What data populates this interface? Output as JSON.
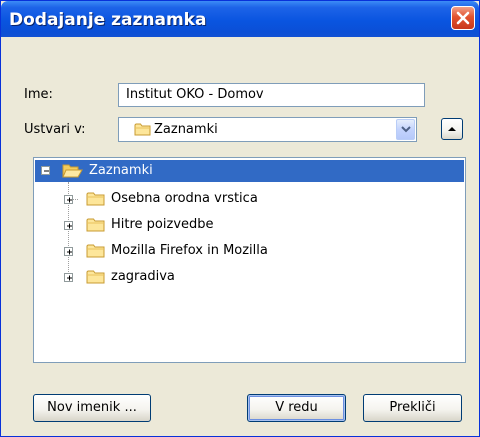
{
  "window": {
    "title": "Dodajanje zaznamka",
    "close_icon": "close-icon"
  },
  "form": {
    "name_label": "Ime:",
    "name_value": "Institut OKO - Domov",
    "create_in_label": "Ustvari v:",
    "create_in_value": "Zaznamki"
  },
  "tree": {
    "root": "Zaznamki",
    "items": [
      {
        "label": "Osebna orodna vrstica"
      },
      {
        "label": "Hitre poizvedbe"
      },
      {
        "label": "Mozilla Firefox in Mozilla"
      },
      {
        "label": "zagradiva"
      }
    ]
  },
  "buttons": {
    "new_folder": "Nov imenik ...",
    "ok": "V redu",
    "cancel": "Prekliči"
  },
  "colors": {
    "title_bar": "#0a55e0",
    "selection": "#316ac5",
    "dialog_bg": "#ece9d8"
  }
}
